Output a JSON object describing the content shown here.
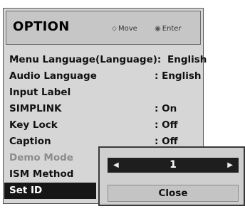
{
  "header": {
    "title": "OPTION",
    "move_label": "Move",
    "enter_label": "Enter",
    "move_icon": "dpad-icon",
    "enter_icon": "circle-icon"
  },
  "menu": {
    "items": [
      {
        "label": "Menu Language(Language):",
        "value": "English"
      },
      {
        "label": "Audio Language",
        "value": ": English"
      },
      {
        "label": "Input Label",
        "value": ""
      },
      {
        "label": "SIMPLINK",
        "value": ": On"
      },
      {
        "label": "Key Lock",
        "value": ": Off"
      },
      {
        "label": "Caption",
        "value": ": Off"
      },
      {
        "label": "Demo Mode",
        "value": ""
      },
      {
        "label": "ISM Method",
        "value": ""
      },
      {
        "label": "Set ID",
        "value": ""
      }
    ]
  },
  "popup": {
    "set_id_value": "1",
    "close_label": "Close"
  }
}
